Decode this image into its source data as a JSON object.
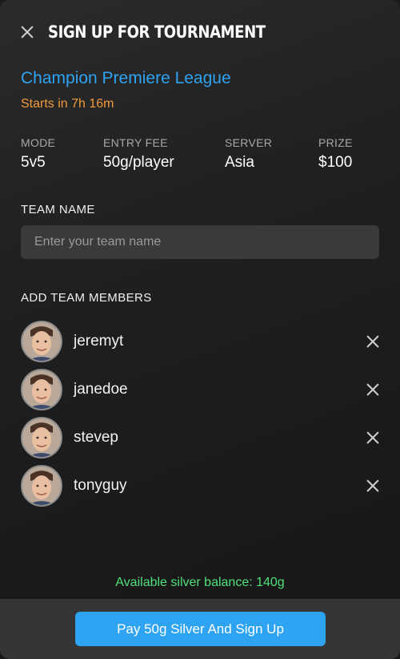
{
  "header": {
    "title": "SIGN UP FOR TOURNAMENT",
    "close_icon": "close-icon"
  },
  "tournament": {
    "name": "Champion Premiere League",
    "starts_in": "Starts in 7h 16m"
  },
  "stats": [
    {
      "label": "MODE",
      "value": "5v5"
    },
    {
      "label": "ENTRY FEE",
      "value": "50g/player"
    },
    {
      "label": "SERVER",
      "value": "Asia"
    },
    {
      "label": "PRIZE",
      "value": "$100"
    }
  ],
  "team_name": {
    "label": "TEAM NAME",
    "placeholder": "Enter your team name",
    "value": ""
  },
  "members": {
    "label": "ADD TEAM MEMBERS",
    "list": [
      {
        "username": "jeremyt"
      },
      {
        "username": "janedoe"
      },
      {
        "username": "stevep"
      },
      {
        "username": "tonyguy"
      }
    ]
  },
  "balance": {
    "text": "Available silver balance: 140g"
  },
  "footer": {
    "pay_label": "Pay 50g Silver And Sign Up"
  },
  "colors": {
    "accent_blue": "#2ea3f2",
    "countdown_orange": "#f29a3a",
    "balance_green": "#4fe07b",
    "background": "#1e1e1e",
    "footer": "#353535"
  }
}
